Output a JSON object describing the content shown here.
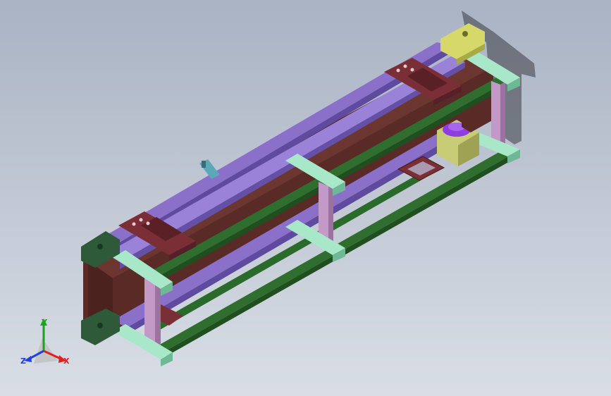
{
  "viewport": {
    "background_top": "#a9b3c4",
    "background_bottom": "#d9dee6"
  },
  "colors": {
    "belt": "#5a2a26",
    "belt_side": "#6b3630",
    "rail_purple": "#8a70c8",
    "rail_green": "#2f6e2f",
    "leg_pink": "#c39ac7",
    "connector_mint": "#a8e8c8",
    "plate_maroon": "#7a2f36",
    "end_block_green": "#2e5a3a",
    "end_block_yellow": "#d6d86a",
    "motor_body": "#c9cc77",
    "motor_cap": "#8e3ee0",
    "axis_x": "#e02020",
    "axis_y": "#20a020",
    "axis_z": "#2040e0"
  },
  "triad": {
    "x_label": "X",
    "y_label": "Y",
    "z_label": "Z"
  },
  "model": {
    "name": "belt-conveyor-assembly",
    "components": [
      "conveyor-belt",
      "upper-rail-left",
      "upper-rail-right",
      "lower-frame-rail",
      "support-legs",
      "crossbar-connectors",
      "mounting-plates",
      "drive-end-block",
      "idler-end-block",
      "drive-motor",
      "sensor-bracket"
    ]
  }
}
